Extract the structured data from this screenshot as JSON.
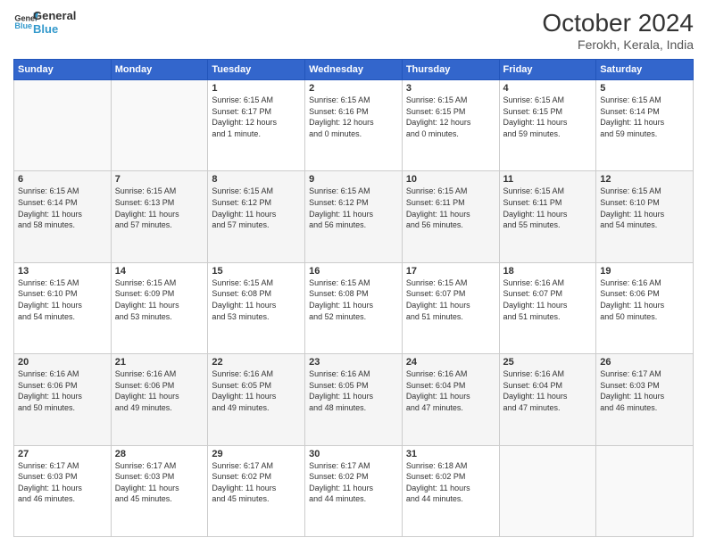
{
  "logo": {
    "line1": "General",
    "line2": "Blue"
  },
  "title": "October 2024",
  "subtitle": "Ferokh, Kerala, India",
  "days_of_week": [
    "Sunday",
    "Monday",
    "Tuesday",
    "Wednesday",
    "Thursday",
    "Friday",
    "Saturday"
  ],
  "weeks": [
    [
      {
        "day": "",
        "info": ""
      },
      {
        "day": "",
        "info": ""
      },
      {
        "day": "1",
        "info": "Sunrise: 6:15 AM\nSunset: 6:17 PM\nDaylight: 12 hours\nand 1 minute."
      },
      {
        "day": "2",
        "info": "Sunrise: 6:15 AM\nSunset: 6:16 PM\nDaylight: 12 hours\nand 0 minutes."
      },
      {
        "day": "3",
        "info": "Sunrise: 6:15 AM\nSunset: 6:15 PM\nDaylight: 12 hours\nand 0 minutes."
      },
      {
        "day": "4",
        "info": "Sunrise: 6:15 AM\nSunset: 6:15 PM\nDaylight: 11 hours\nand 59 minutes."
      },
      {
        "day": "5",
        "info": "Sunrise: 6:15 AM\nSunset: 6:14 PM\nDaylight: 11 hours\nand 59 minutes."
      }
    ],
    [
      {
        "day": "6",
        "info": "Sunrise: 6:15 AM\nSunset: 6:14 PM\nDaylight: 11 hours\nand 58 minutes."
      },
      {
        "day": "7",
        "info": "Sunrise: 6:15 AM\nSunset: 6:13 PM\nDaylight: 11 hours\nand 57 minutes."
      },
      {
        "day": "8",
        "info": "Sunrise: 6:15 AM\nSunset: 6:12 PM\nDaylight: 11 hours\nand 57 minutes."
      },
      {
        "day": "9",
        "info": "Sunrise: 6:15 AM\nSunset: 6:12 PM\nDaylight: 11 hours\nand 56 minutes."
      },
      {
        "day": "10",
        "info": "Sunrise: 6:15 AM\nSunset: 6:11 PM\nDaylight: 11 hours\nand 56 minutes."
      },
      {
        "day": "11",
        "info": "Sunrise: 6:15 AM\nSunset: 6:11 PM\nDaylight: 11 hours\nand 55 minutes."
      },
      {
        "day": "12",
        "info": "Sunrise: 6:15 AM\nSunset: 6:10 PM\nDaylight: 11 hours\nand 54 minutes."
      }
    ],
    [
      {
        "day": "13",
        "info": "Sunrise: 6:15 AM\nSunset: 6:10 PM\nDaylight: 11 hours\nand 54 minutes."
      },
      {
        "day": "14",
        "info": "Sunrise: 6:15 AM\nSunset: 6:09 PM\nDaylight: 11 hours\nand 53 minutes."
      },
      {
        "day": "15",
        "info": "Sunrise: 6:15 AM\nSunset: 6:08 PM\nDaylight: 11 hours\nand 53 minutes."
      },
      {
        "day": "16",
        "info": "Sunrise: 6:15 AM\nSunset: 6:08 PM\nDaylight: 11 hours\nand 52 minutes."
      },
      {
        "day": "17",
        "info": "Sunrise: 6:15 AM\nSunset: 6:07 PM\nDaylight: 11 hours\nand 51 minutes."
      },
      {
        "day": "18",
        "info": "Sunrise: 6:16 AM\nSunset: 6:07 PM\nDaylight: 11 hours\nand 51 minutes."
      },
      {
        "day": "19",
        "info": "Sunrise: 6:16 AM\nSunset: 6:06 PM\nDaylight: 11 hours\nand 50 minutes."
      }
    ],
    [
      {
        "day": "20",
        "info": "Sunrise: 6:16 AM\nSunset: 6:06 PM\nDaylight: 11 hours\nand 50 minutes."
      },
      {
        "day": "21",
        "info": "Sunrise: 6:16 AM\nSunset: 6:06 PM\nDaylight: 11 hours\nand 49 minutes."
      },
      {
        "day": "22",
        "info": "Sunrise: 6:16 AM\nSunset: 6:05 PM\nDaylight: 11 hours\nand 49 minutes."
      },
      {
        "day": "23",
        "info": "Sunrise: 6:16 AM\nSunset: 6:05 PM\nDaylight: 11 hours\nand 48 minutes."
      },
      {
        "day": "24",
        "info": "Sunrise: 6:16 AM\nSunset: 6:04 PM\nDaylight: 11 hours\nand 47 minutes."
      },
      {
        "day": "25",
        "info": "Sunrise: 6:16 AM\nSunset: 6:04 PM\nDaylight: 11 hours\nand 47 minutes."
      },
      {
        "day": "26",
        "info": "Sunrise: 6:17 AM\nSunset: 6:03 PM\nDaylight: 11 hours\nand 46 minutes."
      }
    ],
    [
      {
        "day": "27",
        "info": "Sunrise: 6:17 AM\nSunset: 6:03 PM\nDaylight: 11 hours\nand 46 minutes."
      },
      {
        "day": "28",
        "info": "Sunrise: 6:17 AM\nSunset: 6:03 PM\nDaylight: 11 hours\nand 45 minutes."
      },
      {
        "day": "29",
        "info": "Sunrise: 6:17 AM\nSunset: 6:02 PM\nDaylight: 11 hours\nand 45 minutes."
      },
      {
        "day": "30",
        "info": "Sunrise: 6:17 AM\nSunset: 6:02 PM\nDaylight: 11 hours\nand 44 minutes."
      },
      {
        "day": "31",
        "info": "Sunrise: 6:18 AM\nSunset: 6:02 PM\nDaylight: 11 hours\nand 44 minutes."
      },
      {
        "day": "",
        "info": ""
      },
      {
        "day": "",
        "info": ""
      }
    ]
  ]
}
